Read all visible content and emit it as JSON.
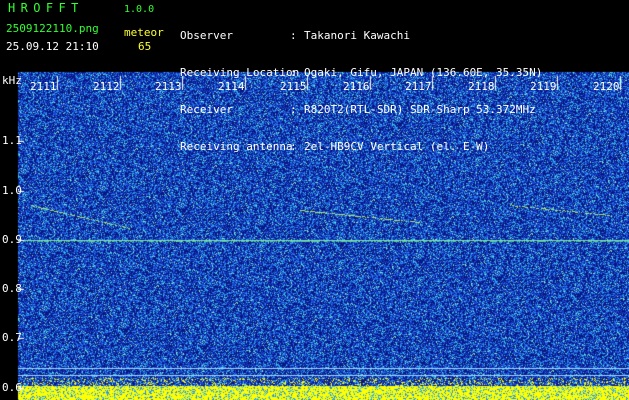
{
  "header": {
    "app_title": "HROFFT",
    "app_version": "1.0.0",
    "file_name": "2509122110.png",
    "datetime": "25.09.12 21:10",
    "meteor_label": "meteor",
    "meteor_count": "65"
  },
  "info": [
    {
      "label": "Observer",
      "value": "Takanori Kawachi"
    },
    {
      "label": "Receiving Location",
      "value": "Ogaki, Gifu, JAPAN (136.60E, 35.35N)"
    },
    {
      "label": "Receiver",
      "value": "R820T2(RTL-SDR) SDR-Sharp 53.372MHz"
    },
    {
      "label": "Receiving antenna",
      "value": "2el-HB9CV Vertical (el. E-W)"
    }
  ],
  "info_separator": ":",
  "axis": {
    "unit": "kHz",
    "y_ticks": [
      "1.1",
      "1.0",
      "0.9",
      "0.8",
      "0.7",
      "0.6"
    ],
    "y_values": [
      1.1,
      1.0,
      0.9,
      0.8,
      0.7,
      0.6
    ],
    "y_range": [
      0.575,
      1.2
    ],
    "x_ticks": [
      "2111",
      "2112",
      "2113",
      "2114",
      "2115",
      "2116",
      "2117",
      "2118",
      "2119",
      "2120"
    ],
    "x_values": [
      2111,
      2112,
      2113,
      2114,
      2115,
      2116,
      2117,
      2118,
      2119,
      2120
    ],
    "x_range": [
      2110.4,
      2120.15
    ]
  },
  "colors": {
    "background": "#000000",
    "noise_dark": "#0a1a8a",
    "noise_mid": "#1e5ad8",
    "noise_light": "#33c6e8",
    "carrier": "#ffff00",
    "title": "#33ff33",
    "info_text": "#ffffff",
    "tick_text": "#ffffff"
  },
  "carrier_kHz": 0.9
}
